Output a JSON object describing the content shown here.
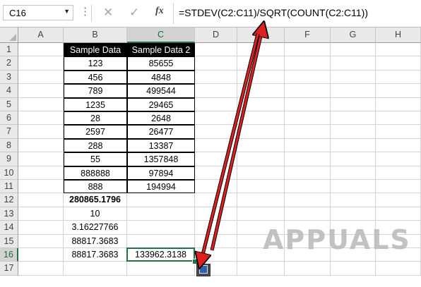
{
  "formula_bar": {
    "name_box": "C16",
    "fx_label": "fx",
    "formula": "=STDEV(C2:C11)/SQRT(COUNT(C2:C11))"
  },
  "columns": [
    "A",
    "B",
    "C",
    "D",
    "E",
    "F",
    "G",
    "H"
  ],
  "rows": [
    "1",
    "2",
    "3",
    "4",
    "5",
    "6",
    "7",
    "8",
    "9",
    "10",
    "11",
    "12",
    "13",
    "14",
    "15",
    "16",
    "17"
  ],
  "table": {
    "headers": [
      "Sample Data",
      "Sample Data 2"
    ],
    "rows": [
      [
        "123",
        "85655"
      ],
      [
        "456",
        "4848"
      ],
      [
        "789",
        "499544"
      ],
      [
        "1235",
        "29465"
      ],
      [
        "28",
        "2648"
      ],
      [
        "2597",
        "26477"
      ],
      [
        "288",
        "13387"
      ],
      [
        "55",
        "1357848"
      ],
      [
        "888888",
        "97894"
      ],
      [
        "888",
        "194994"
      ]
    ]
  },
  "results": {
    "b12": "280865.1796",
    "b13": "10",
    "b14": "3.16227766",
    "b15": "88817.3683",
    "b16": "88817.3683",
    "c16": "133962.3138"
  },
  "watermark": "APPUALS",
  "colors": {
    "accent": "#217346",
    "arrow": "#e02020"
  }
}
